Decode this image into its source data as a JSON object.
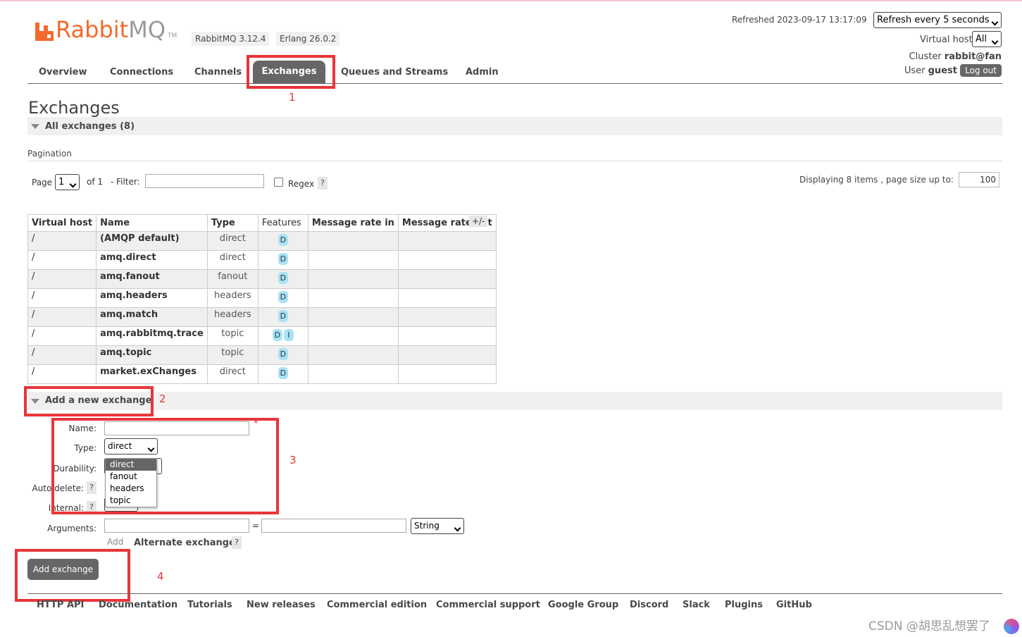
{
  "header": {
    "logo_text_a": "Rabbit",
    "logo_text_b": "MQ",
    "logo_tm": "TM",
    "version": "RabbitMQ 3.12.4",
    "erlang": "Erlang 26.0.2",
    "refreshed": "Refreshed 2023-09-17 13:17:09",
    "refresh_select": "Refresh every 5 seconds",
    "vhost_label": "Virtual host",
    "vhost_value": "All",
    "cluster_label": "Cluster",
    "cluster_value": "rabbit@fan",
    "user_label": "User",
    "user_value": "guest",
    "logout": "Log out"
  },
  "nav": {
    "overview": "Overview",
    "connections": "Connections",
    "channels": "Channels",
    "exchanges": "Exchanges",
    "queues": "Queues and Streams",
    "admin": "Admin"
  },
  "annotations": [
    "1",
    "2",
    "3",
    "4"
  ],
  "page": {
    "title": "Exchanges",
    "all_exchanges": "All exchanges (8)"
  },
  "pagination": {
    "heading": "Pagination",
    "page_label": "Page",
    "page_value": "1",
    "of": "of 1",
    "filter_label": "- Filter:",
    "regex_label": "Regex",
    "help": "?",
    "displaying": "Displaying 8 items , page size up to:",
    "page_size": "100"
  },
  "table": {
    "headers": [
      "Virtual host",
      "Name",
      "Type",
      "Features",
      "Message rate in",
      "Message rate out"
    ],
    "plusminus": "+/-",
    "rows": [
      {
        "vhost": "/",
        "name": "(AMQP default)",
        "type": "direct",
        "features": [
          "D"
        ]
      },
      {
        "vhost": "/",
        "name": "amq.direct",
        "type": "direct",
        "features": [
          "D"
        ]
      },
      {
        "vhost": "/",
        "name": "amq.fanout",
        "type": "fanout",
        "features": [
          "D"
        ]
      },
      {
        "vhost": "/",
        "name": "amq.headers",
        "type": "headers",
        "features": [
          "D"
        ]
      },
      {
        "vhost": "/",
        "name": "amq.match",
        "type": "headers",
        "features": [
          "D"
        ]
      },
      {
        "vhost": "/",
        "name": "amq.rabbitmq.trace",
        "type": "topic",
        "features": [
          "D",
          "I"
        ]
      },
      {
        "vhost": "/",
        "name": "amq.topic",
        "type": "topic",
        "features": [
          "D"
        ]
      },
      {
        "vhost": "/",
        "name": "market.exChanges",
        "type": "direct",
        "features": [
          "D"
        ]
      }
    ]
  },
  "add_exchange": {
    "heading": "Add a new exchange",
    "name_label": "Name:",
    "required_mark": "*",
    "type_label": "Type:",
    "type_value": "direct",
    "type_options": [
      "direct",
      "fanout",
      "headers",
      "topic"
    ],
    "durability_label": "Durability:",
    "autodelete_label": "Auto delete:",
    "internal_label": "Internal:",
    "internal_value": "No",
    "arguments_label": "Arguments:",
    "equals": "=",
    "arg_type": "String",
    "add_link": "Add",
    "alternate": "Alternate exchange",
    "button": "Add exchange"
  },
  "footer": {
    "links": [
      "HTTP API",
      "Documentation",
      "Tutorials",
      "New releases",
      "Commercial edition",
      "Commercial support",
      "Google Group",
      "Discord",
      "Slack",
      "Plugins",
      "GitHub"
    ]
  },
  "watermark": "CSDN @胡思乱想罢了"
}
